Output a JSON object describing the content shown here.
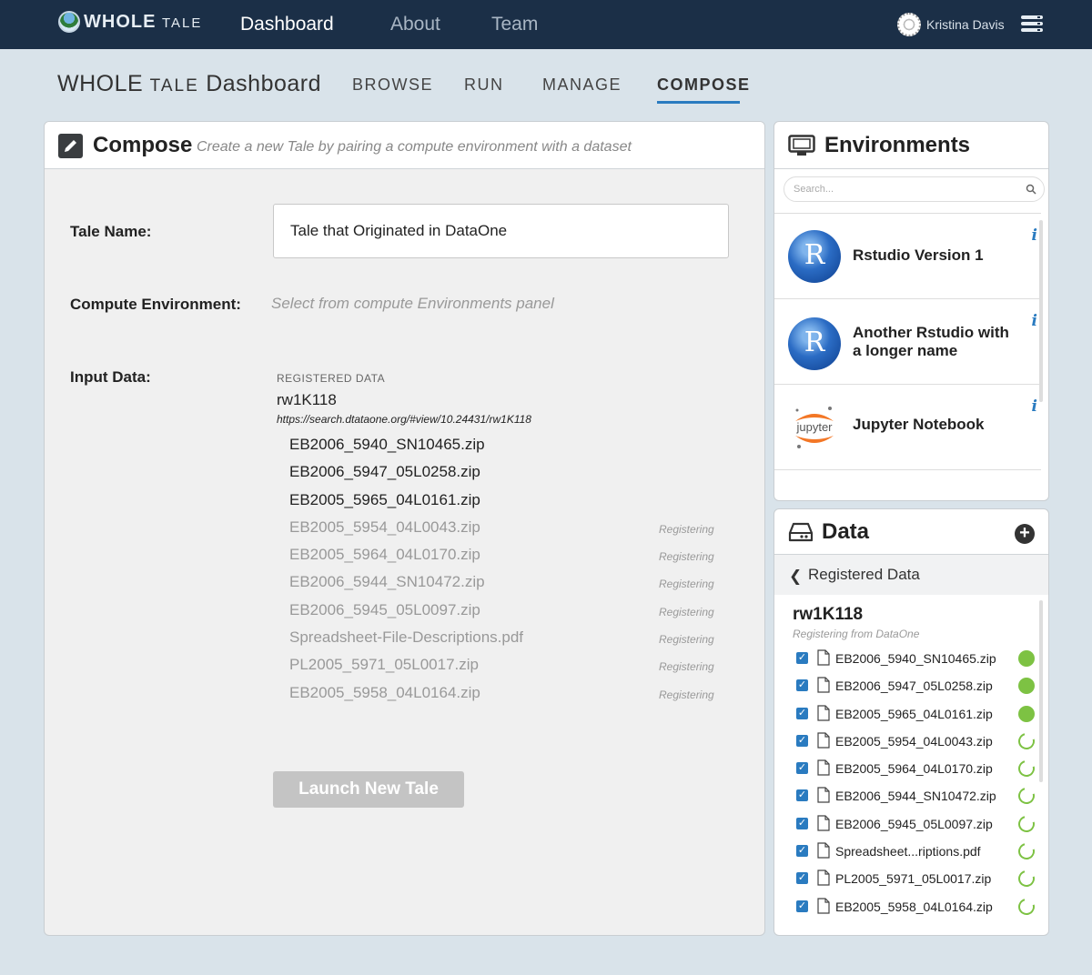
{
  "topnav": {
    "logo": {
      "big": "WHOLE",
      "small": "TALE"
    },
    "items": [
      "Dashboard",
      "About",
      "Team"
    ],
    "user": "Kristina Davis"
  },
  "subheader": {
    "title_big": "WHOLE",
    "title_small": "TALE",
    "title_rest": "Dashboard",
    "tabs": [
      "BROWSE",
      "RUN",
      "MANAGE",
      "COMPOSE"
    ],
    "active_tab": "COMPOSE"
  },
  "compose": {
    "title": "Compose",
    "subtitle": "Create a new Tale by pairing a compute environment with a dataset",
    "tale_name_label": "Tale Name:",
    "tale_name_value": "Tale that Originated in DataOne",
    "env_label": "Compute Environment:",
    "env_hint": "Select from compute Environments panel",
    "input_label": "Input Data:",
    "registered_label": "REGISTERED DATA",
    "dataset_id": "rw1K118",
    "dataset_url": "https://search.dtataone.org/#view/10.24431/rw1K118",
    "files": [
      {
        "name": "EB2006_5940_SN10465.zip",
        "status": ""
      },
      {
        "name": "EB2006_5947_05L0258.zip",
        "status": ""
      },
      {
        "name": "EB2005_5965_04L0161.zip",
        "status": ""
      },
      {
        "name": "EB2005_5954_04L0043.zip",
        "status": "Registering"
      },
      {
        "name": "EB2005_5964_04L0170.zip",
        "status": "Registering"
      },
      {
        "name": "EB2006_5944_SN10472.zip",
        "status": "Registering"
      },
      {
        "name": "EB2006_5945_05L0097.zip",
        "status": "Registering"
      },
      {
        "name": "Spreadsheet-File-Descriptions.pdf",
        "status": "Registering"
      },
      {
        "name": "PL2005_5971_05L0017.zip",
        "status": "Registering"
      },
      {
        "name": "EB2005_5958_04L0164.zip",
        "status": "Registering"
      }
    ],
    "launch_label": "Launch New Tale"
  },
  "environments": {
    "title": "Environments",
    "search_placeholder": "Search...",
    "items": [
      {
        "name": "Rstudio Version 1",
        "icon": "r-logo-icon"
      },
      {
        "name": "Another Rstudio with a longer name",
        "icon": "r-logo-icon"
      },
      {
        "name": "Jupyter Notebook",
        "icon": "jupyter-logo-icon"
      }
    ]
  },
  "data": {
    "title": "Data",
    "back_label": "Registered Data",
    "dataset_id": "rw1K118",
    "dataset_sub": "Registering from DataOne",
    "files": [
      {
        "name": "EB2006_5940_SN10465.zip",
        "state": "done"
      },
      {
        "name": "EB2006_5947_05L0258.zip",
        "state": "done"
      },
      {
        "name": "EB2005_5965_04L0161.zip",
        "state": "done"
      },
      {
        "name": "EB2005_5954_04L0043.zip",
        "state": "pending"
      },
      {
        "name": "EB2005_5964_04L0170.zip",
        "state": "pending"
      },
      {
        "name": "EB2006_5944_SN10472.zip",
        "state": "pending"
      },
      {
        "name": "EB2006_5945_05L0097.zip",
        "state": "pending"
      },
      {
        "name": "Spreadsheet...riptions.pdf",
        "state": "pending"
      },
      {
        "name": "PL2005_5971_05L0017.zip",
        "state": "pending"
      },
      {
        "name": "EB2005_5958_04L0164.zip",
        "state": "pending"
      }
    ]
  },
  "colors": {
    "nav_bg": "#1b2f47",
    "accent": "#2a7bc0",
    "ok_green": "#7dc243"
  }
}
